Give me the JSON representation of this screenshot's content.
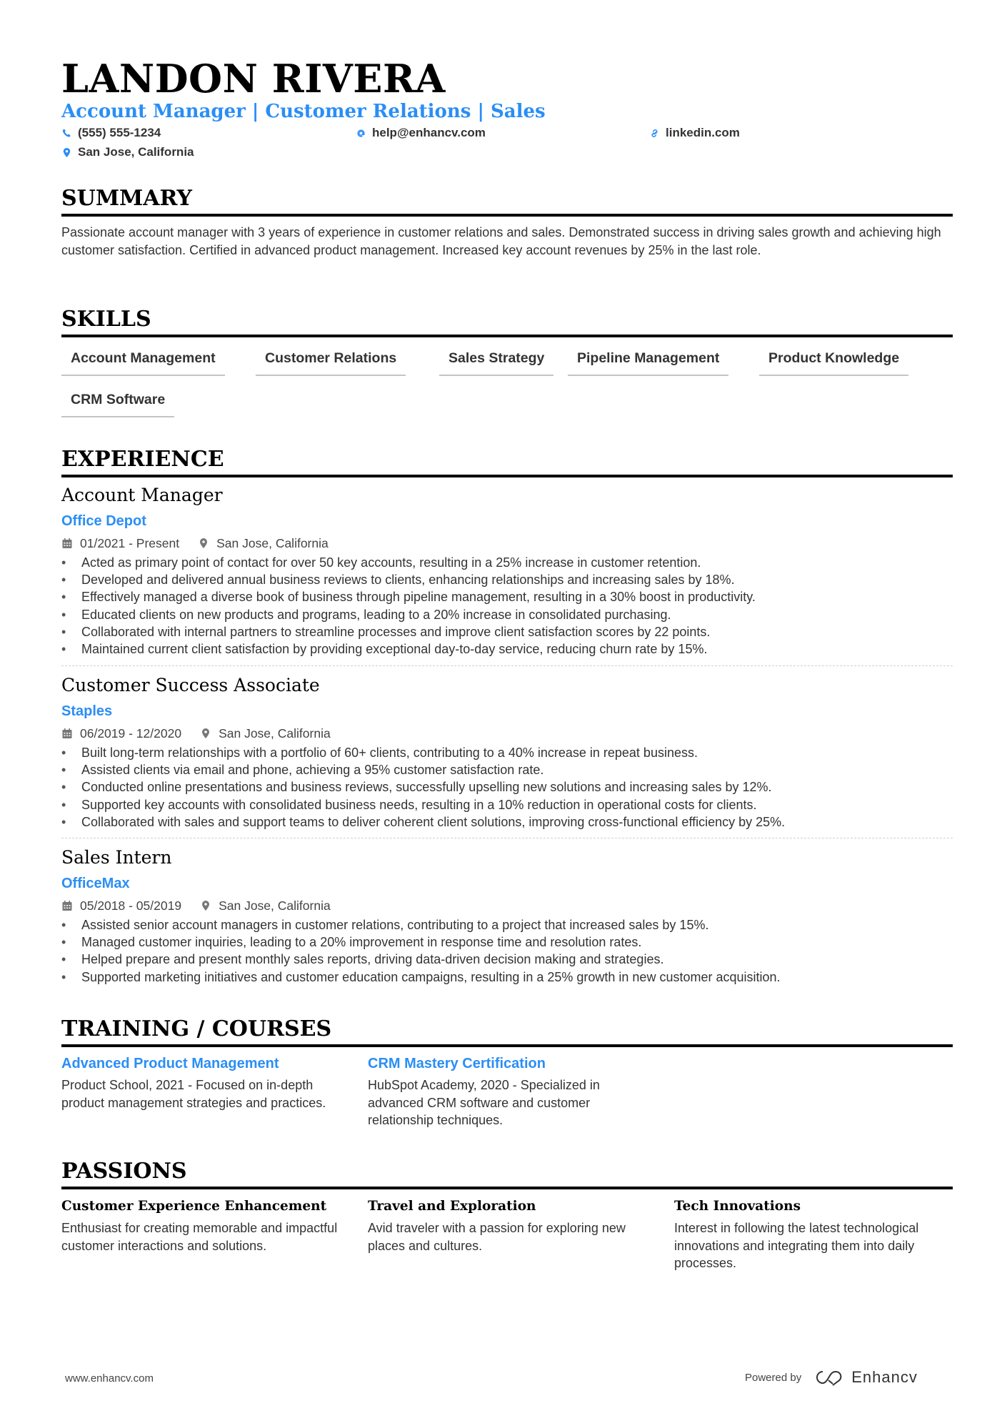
{
  "header": {
    "name": "LANDON RIVERA",
    "subtitle": "Account Manager | Customer Relations | Sales",
    "phone": "(555) 555-1234",
    "email": "help@enhancv.com",
    "website": "linkedin.com",
    "location": "San Jose, California"
  },
  "summary": {
    "title": "SUMMARY",
    "text": "Passionate account manager with 3 years of experience in customer relations and sales. Demonstrated success in driving sales growth and achieving high customer satisfaction. Certified in advanced product management. Increased key account revenues by 25% in the last role."
  },
  "skills": {
    "title": "SKILLS",
    "items": [
      "Account Management",
      "Customer Relations",
      "Sales Strategy",
      "Pipeline Management",
      "Product Knowledge",
      "CRM Software"
    ]
  },
  "experience": {
    "title": "EXPERIENCE",
    "jobs": [
      {
        "title": "Account Manager",
        "company": "Office Depot",
        "dates": "01/2021 - Present",
        "location": "San Jose, California",
        "bullets": [
          "Acted as primary point of contact for over 50 key accounts, resulting in a 25% increase in customer retention.",
          "Developed and delivered annual business reviews to clients, enhancing relationships and increasing sales by 18%.",
          "Effectively managed a diverse book of business through pipeline management, resulting in a 30% boost in productivity.",
          "Educated clients on new products and programs, leading to a 20% increase in consolidated purchasing.",
          "Collaborated with internal partners to streamline processes and improve client satisfaction scores by 22 points.",
          "Maintained current client satisfaction by providing exceptional day-to-day service, reducing churn rate by 15%."
        ]
      },
      {
        "title": "Customer Success Associate",
        "company": "Staples",
        "dates": "06/2019 - 12/2020",
        "location": "San Jose, California",
        "bullets": [
          "Built long-term relationships with a portfolio of 60+ clients, contributing to a 40% increase in repeat business.",
          "Assisted clients via email and phone, achieving a 95% customer satisfaction rate.",
          "Conducted online presentations and business reviews, successfully upselling new solutions and increasing sales by 12%.",
          "Supported key accounts with consolidated business needs, resulting in a 10% reduction in operational costs for clients.",
          "Collaborated with sales and support teams to deliver coherent client solutions, improving cross-functional efficiency by 25%."
        ]
      },
      {
        "title": "Sales Intern",
        "company": "OfficeMax",
        "dates": "05/2018 - 05/2019",
        "location": "San Jose, California",
        "bullets": [
          "Assisted senior account managers in customer relations, contributing to a project that increased sales by 15%.",
          "Managed customer inquiries, leading to a 20% improvement in response time and resolution rates.",
          "Helped prepare and present monthly sales reports, driving data-driven decision making and strategies.",
          "Supported marketing initiatives and customer education campaigns, resulting in a 25% growth in new customer acquisition."
        ]
      }
    ]
  },
  "training": {
    "title": "TRAINING / COURSES",
    "items": [
      {
        "title": "Advanced Product Management",
        "desc": "Product School, 2021 - Focused on in-depth product management strategies and practices."
      },
      {
        "title": "CRM Mastery Certification",
        "desc": "HubSpot Academy, 2020 - Specialized in advanced CRM software and customer relationship techniques."
      }
    ]
  },
  "passions": {
    "title": "PASSIONS",
    "items": [
      {
        "title": "Customer Experience Enhancement",
        "desc": "Enthusiast for creating memorable and impactful customer interactions and solutions."
      },
      {
        "title": "Travel and Exploration",
        "desc": "Avid traveler with a passion for exploring new places and cultures."
      },
      {
        "title": "Tech Innovations",
        "desc": "Interest in following the latest technological innovations and integrating them into daily processes."
      }
    ]
  },
  "footer": {
    "website": "www.enhancv.com",
    "powered_by": "Powered by",
    "brand": "Enhancv"
  },
  "colors": {
    "accent": "#2a8ef5",
    "text": "#333333",
    "heading": "#000000"
  }
}
